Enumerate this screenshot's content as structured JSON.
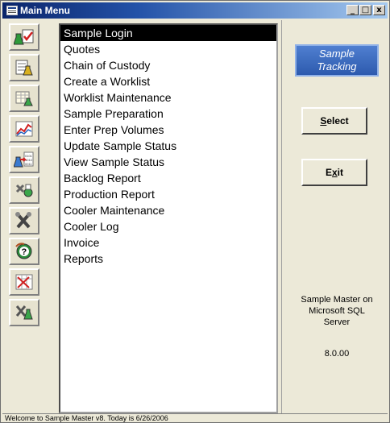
{
  "window": {
    "title": "Main Menu",
    "controls": {
      "minimize": "_",
      "maximize": "□",
      "close": "x"
    }
  },
  "toolbar": {
    "icons": [
      "sample-login-icon",
      "worklist-icon",
      "sample-prep-icon",
      "status-chart-icon",
      "data-transfer-icon",
      "cooler-tools-icon",
      "maintenance-tools-icon",
      "help-icon",
      "calendar-report-icon",
      "lab-tools-icon"
    ]
  },
  "menu": {
    "selected_index": 0,
    "items": [
      "Sample Login",
      "Quotes",
      "Chain of Custody",
      "Create a Worklist",
      "Worklist Maintenance",
      "Sample Preparation",
      "Enter Prep Volumes",
      "Update Sample Status",
      "View Sample Status",
      "Backlog Report",
      "Production Report",
      "Cooler Maintenance",
      "Cooler Log",
      "Invoice",
      "Reports"
    ]
  },
  "panel": {
    "badge_line1": "Sample",
    "badge_line2": "Tracking",
    "select_button": {
      "hotkey": "S",
      "rest": "elect"
    },
    "exit_button": {
      "prefix": "E",
      "hotkey": "x",
      "rest": "it"
    },
    "info_line1": "Sample Master on",
    "info_line2": "Microsoft SQL",
    "info_line3": "Server",
    "version": "8.0.00"
  },
  "status": {
    "text": "Welcome to Sample Master v8.  Today is 6/26/2006"
  },
  "colors": {
    "title_start": "#0a246a",
    "title_end": "#a6caf0",
    "badge": "#3d6ac0",
    "selection": "#000000"
  }
}
